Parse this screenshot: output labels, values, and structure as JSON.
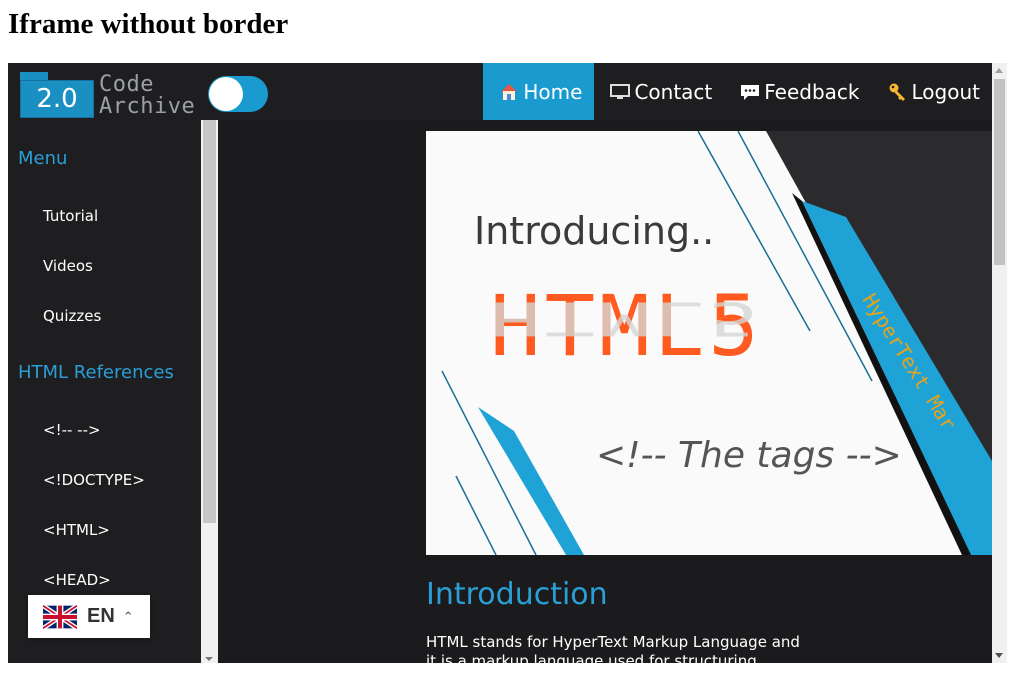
{
  "page": {
    "title": "Iframe without border"
  },
  "logo": {
    "badge": "2.0",
    "line1": "Code",
    "line2": "Archive"
  },
  "nav": [
    {
      "label": "Home",
      "icon": "home-icon",
      "active": true
    },
    {
      "label": "Contact",
      "icon": "monitor-icon",
      "active": false
    },
    {
      "label": "Feedback",
      "icon": "chat-icon",
      "active": false
    },
    {
      "label": "Logout",
      "icon": "key-icon",
      "active": false
    }
  ],
  "sidebar": {
    "menu_heading": "Menu",
    "menu_items": [
      "Tutorial",
      "Videos",
      "Quizzes"
    ],
    "ref_heading": "HTML References",
    "ref_items": [
      "<!-- -->",
      "<!DOCTYPE>",
      "<HTML>",
      "<HEAD>"
    ]
  },
  "hero": {
    "line1": "Introducing..",
    "line2": "HTML5",
    "line3": "<!-- The tags -->",
    "side_text": "HyperText Mar"
  },
  "content": {
    "heading": "Introduction",
    "text": "HTML stands for HyperText Markup Language and it is a markup language used for structuring"
  },
  "language": {
    "code": "EN"
  },
  "colors": {
    "accent": "#1a9bd0",
    "background": "#1b1b1d",
    "html5_orange": "#ff5a1f"
  }
}
